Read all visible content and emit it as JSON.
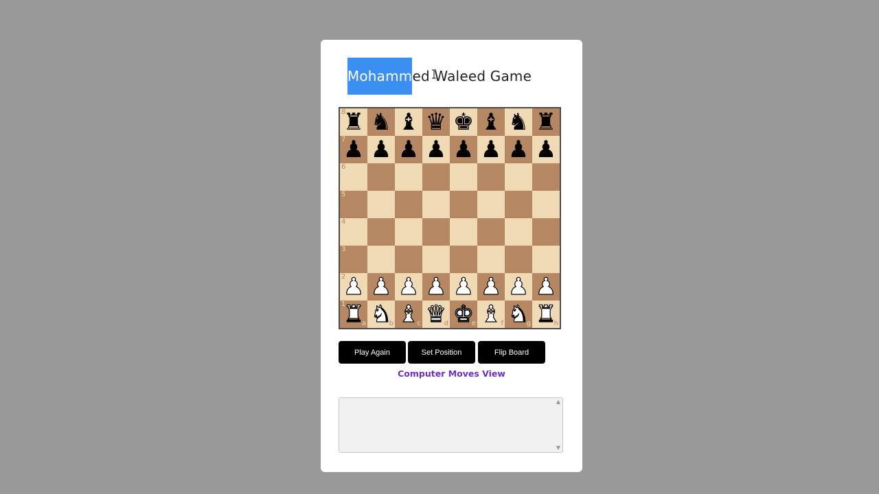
{
  "title": {
    "selected": "Mohamm",
    "rest": "ed Waleed Game"
  },
  "board": {
    "ranks": [
      "8",
      "7",
      "6",
      "5",
      "4",
      "3",
      "2",
      "1"
    ],
    "files": [
      "a",
      "b",
      "c",
      "d",
      "e",
      "f",
      "g",
      "h"
    ],
    "position": [
      [
        "r",
        "n",
        "b",
        "q",
        "k",
        "b",
        "n",
        "r"
      ],
      [
        "p",
        "p",
        "p",
        "p",
        "p",
        "p",
        "p",
        "p"
      ],
      [
        "",
        "",
        "",
        "",
        "",
        "",
        "",
        ""
      ],
      [
        "",
        "",
        "",
        "",
        "",
        "",
        "",
        ""
      ],
      [
        "",
        "",
        "",
        "",
        "",
        "",
        "",
        ""
      ],
      [
        "",
        "",
        "",
        "",
        "",
        "",
        "",
        ""
      ],
      [
        "P",
        "P",
        "P",
        "P",
        "P",
        "P",
        "P",
        "P"
      ],
      [
        "R",
        "N",
        "B",
        "Q",
        "K",
        "B",
        "N",
        "R"
      ]
    ],
    "light_color": "#f0d9b5",
    "dark_color": "#b58863"
  },
  "buttons": {
    "play_again": "Play Again",
    "set_position": "Set Position",
    "flip_board": "Flip Board"
  },
  "computer_moves_link": "Computer Moves View",
  "moves_output": ""
}
